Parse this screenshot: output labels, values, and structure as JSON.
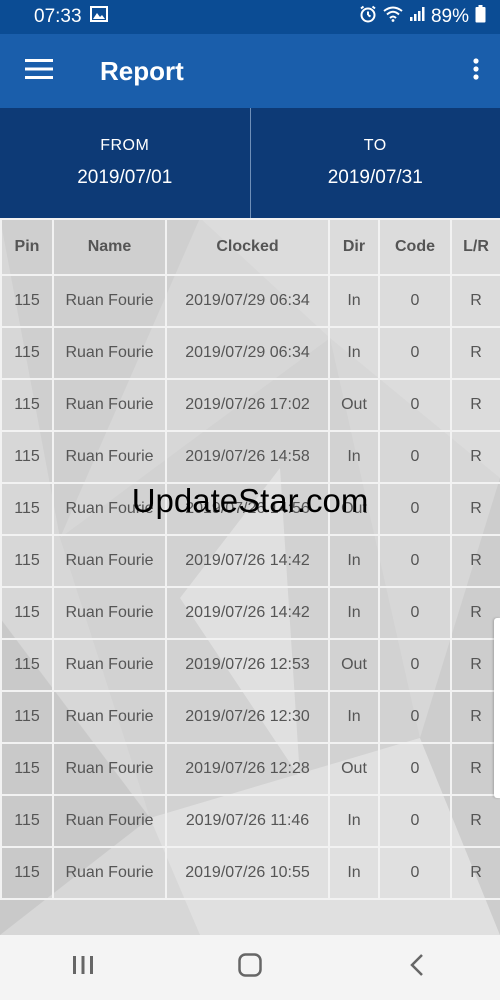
{
  "status_bar": {
    "time": "07:33",
    "battery_percent": "89%",
    "icons": [
      "image-icon",
      "alarm-icon",
      "wifi-icon",
      "signal-icon",
      "battery-icon"
    ]
  },
  "app_bar": {
    "title": "Report",
    "menu_icon": "hamburger-menu-icon",
    "more_icon": "more-vertical-icon"
  },
  "date_range": {
    "from_label": "FROM",
    "from_value": "2019/07/01",
    "to_label": "TO",
    "to_value": "2019/07/31"
  },
  "table": {
    "headers": [
      "Pin",
      "Name",
      "Clocked",
      "Dir",
      "Code",
      "L/R"
    ],
    "rows": [
      [
        "115",
        "Ruan Fourie",
        "2019/07/29 06:34",
        "In",
        "0",
        "R"
      ],
      [
        "115",
        "Ruan Fourie",
        "2019/07/29 06:34",
        "In",
        "0",
        "R"
      ],
      [
        "115",
        "Ruan Fourie",
        "2019/07/26 17:02",
        "Out",
        "0",
        "R"
      ],
      [
        "115",
        "Ruan Fourie",
        "2019/07/26 14:58",
        "In",
        "0",
        "R"
      ],
      [
        "115",
        "Ruan Fourie",
        "2019/07/26 14:56",
        "Out",
        "0",
        "R"
      ],
      [
        "115",
        "Ruan Fourie",
        "2019/07/26 14:42",
        "In",
        "0",
        "R"
      ],
      [
        "115",
        "Ruan Fourie",
        "2019/07/26 14:42",
        "In",
        "0",
        "R"
      ],
      [
        "115",
        "Ruan Fourie",
        "2019/07/26 12:53",
        "Out",
        "0",
        "R"
      ],
      [
        "115",
        "Ruan Fourie",
        "2019/07/26 12:30",
        "In",
        "0",
        "R"
      ],
      [
        "115",
        "Ruan Fourie",
        "2019/07/26 12:28",
        "Out",
        "0",
        "R"
      ],
      [
        "115",
        "Ruan Fourie",
        "2019/07/26 11:46",
        "In",
        "0",
        "R"
      ],
      [
        "115",
        "Ruan Fourie",
        "2019/07/26 10:55",
        "In",
        "0",
        "R"
      ]
    ]
  },
  "watermark": "UpdateStar.com",
  "nav_bar": {
    "icons": [
      "recent-apps-icon",
      "home-icon",
      "back-icon"
    ]
  },
  "colors": {
    "status_bar": "#0b4c94",
    "app_bar": "#1a5eab",
    "date_range": "#0d3a76",
    "table_bg": "#d7d7d7"
  }
}
